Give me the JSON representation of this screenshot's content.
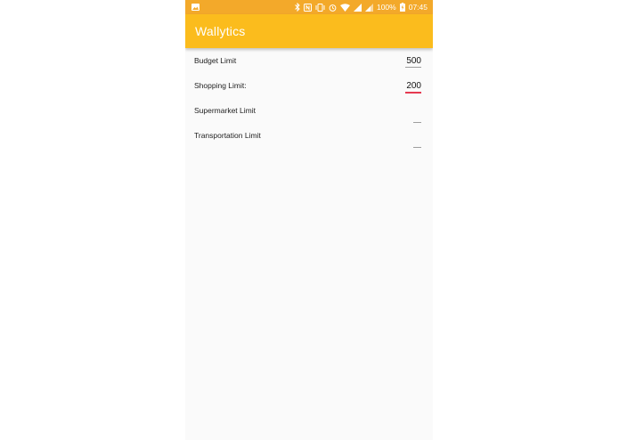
{
  "status_bar": {
    "battery_percent": "100%",
    "time": "07:45",
    "icons": [
      "image-icon",
      "bluetooth-icon",
      "nfc-icon",
      "vibrate-icon",
      "alarm-icon",
      "wifi-icon",
      "signal-icon",
      "signal-icon",
      "battery-charging-icon"
    ]
  },
  "app_bar": {
    "title": "Wallytics"
  },
  "limits": [
    {
      "label": "Budget Limit",
      "value": "500"
    },
    {
      "label": "Shopping Limit:",
      "value": "200"
    },
    {
      "label": "Supermarket Limit",
      "value": ""
    },
    {
      "label": "Transportation Limit",
      "value": ""
    }
  ],
  "colors": {
    "app_bar": "#fbbc1d",
    "status_bar": "#f3a92a",
    "focused_underline": "#e53950",
    "background": "#fafafa"
  }
}
